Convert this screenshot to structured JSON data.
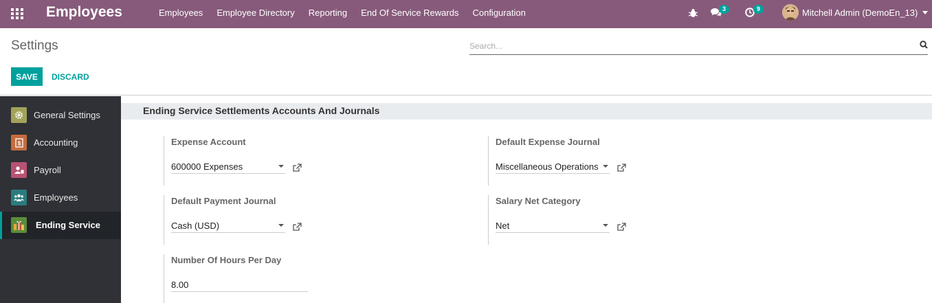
{
  "navbar": {
    "brand": "Employees",
    "menu": [
      {
        "label": "Employees"
      },
      {
        "label": "Employee Directory"
      },
      {
        "label": "Reporting"
      },
      {
        "label": "End Of Service Rewards"
      },
      {
        "label": "Configuration"
      }
    ],
    "messages_count": "3",
    "activities_count": "9",
    "user_name": "Mitchell Admin (DemoEn_13)"
  },
  "control_panel": {
    "breadcrumb": "Settings",
    "search_placeholder": "Search...",
    "save_label": "SAVE",
    "discard_label": "DISCARD"
  },
  "sidebar": {
    "items": [
      {
        "label": "General Settings",
        "icon": "gear-icon",
        "color": "#a2a35a"
      },
      {
        "label": "Accounting",
        "icon": "invoice-icon",
        "color": "#c46b3f"
      },
      {
        "label": "Payroll",
        "icon": "payroll-icon",
        "color": "#b85272"
      },
      {
        "label": "Employees",
        "icon": "people-icon",
        "color": "#2b7c7e"
      },
      {
        "label": "Ending Service",
        "icon": "gift-icon",
        "color": "#5b8c3a"
      }
    ],
    "active_index": 4
  },
  "main": {
    "section_title": "Ending Service Settlements Accounts And Journals",
    "settings": {
      "expense_account": {
        "label": "Expense Account",
        "value": "600000 Expenses"
      },
      "default_expense_journal": {
        "label": "Default Expense Journal",
        "value": "Miscellaneous Operations"
      },
      "default_payment_journal": {
        "label": "Default Payment Journal",
        "value": "Cash (USD)"
      },
      "salary_net_category": {
        "label": "Salary Net Category",
        "value": "Net"
      },
      "hours_per_day": {
        "label": "Number Of Hours Per Day",
        "value": "8.00"
      }
    }
  },
  "colors": {
    "navbar": "#875a7b",
    "accent": "#00a09d",
    "sidebar": "#2f3136"
  }
}
